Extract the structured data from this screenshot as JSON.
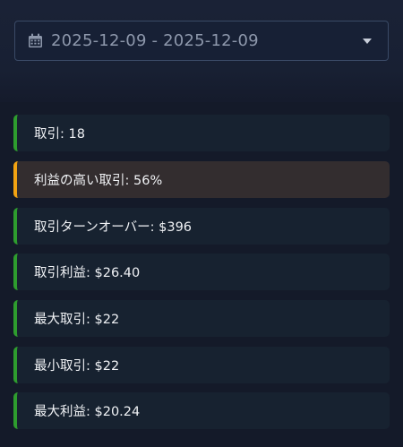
{
  "date_range": {
    "value": "2025-12-09 - 2025-12-09",
    "icon": "calendar-icon"
  },
  "colors": {
    "success_accent": "#2e9d2e",
    "warning_accent": "#f3a312"
  },
  "stats": [
    {
      "text": "取引: 18",
      "status": "success"
    },
    {
      "text": "利益の高い取引: 56%",
      "status": "warning"
    },
    {
      "text": "取引ターンオーバー: $396",
      "status": "success"
    },
    {
      "text": "取引利益: $26.40",
      "status": "success"
    },
    {
      "text": "最大取引: $22",
      "status": "success"
    },
    {
      "text": "最小取引: $22",
      "status": "success"
    },
    {
      "text": "最大利益: $20.24",
      "status": "success"
    }
  ]
}
